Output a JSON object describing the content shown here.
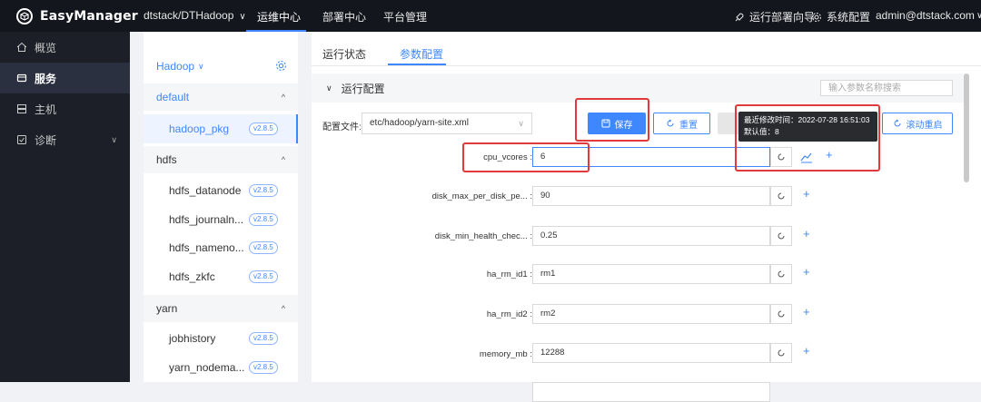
{
  "topbar": {
    "logo": "EasyManager",
    "project": "dtstack/DTHadoop",
    "nav": [
      "运维中心",
      "部署中心",
      "平台管理"
    ],
    "wizard": "运行部署向导",
    "sysconfig": "系统配置",
    "user": "admin@dtstack.com"
  },
  "sidebar": {
    "items": [
      {
        "icon": "home-icon",
        "label": "概览"
      },
      {
        "icon": "service-icon",
        "label": "服务"
      },
      {
        "icon": "host-icon",
        "label": "主机"
      },
      {
        "icon": "diagnose-icon",
        "label": "诊断"
      }
    ]
  },
  "services": {
    "head": "Hadoop",
    "groups": [
      {
        "name": "default",
        "items": [
          {
            "name": "hadoop_pkg",
            "version": "v2.8.5"
          }
        ]
      },
      {
        "name": "hdfs",
        "items": [
          {
            "name": "hdfs_datanode",
            "version": "v2.8.5"
          },
          {
            "name": "hdfs_journaln...",
            "version": "v2.8.5"
          },
          {
            "name": "hdfs_nameno...",
            "version": "v2.8.5"
          },
          {
            "name": "hdfs_zkfc",
            "version": "v2.8.5"
          }
        ]
      },
      {
        "name": "yarn",
        "items": [
          {
            "name": "jobhistory",
            "version": "v2.8.5"
          },
          {
            "name": "yarn_nodema...",
            "version": "v2.8.5"
          }
        ]
      }
    ]
  },
  "main": {
    "tabs": [
      "运行状态",
      "参数配置"
    ],
    "section": "运行配置",
    "search_placeholder": "输入参数名称搜索",
    "config_label": "配置文件:",
    "config_file": "etc/hadoop/yarn-site.xml",
    "save": "保存",
    "reset": "重置",
    "rolling_restart": "滚动重启",
    "tooltip": {
      "line1": "最近修改时间：2022-07-28 16:51:03",
      "line2": "默认值：8"
    },
    "params": [
      {
        "name": "cpu_vcores",
        "value": "6"
      },
      {
        "name": "disk_max_per_disk_pe...",
        "value": "90"
      },
      {
        "name": "disk_min_health_chec...",
        "value": "0.25"
      },
      {
        "name": "ha_rm_id1",
        "value": "rm1"
      },
      {
        "name": "ha_rm_id2",
        "value": "rm2"
      },
      {
        "name": "memory_mb",
        "value": "12288"
      }
    ]
  },
  "colors": {
    "accent": "#3f87ff",
    "highlight": "#e23a3a",
    "topbar": "#14161d",
    "sidebar": "#1c1f28"
  }
}
